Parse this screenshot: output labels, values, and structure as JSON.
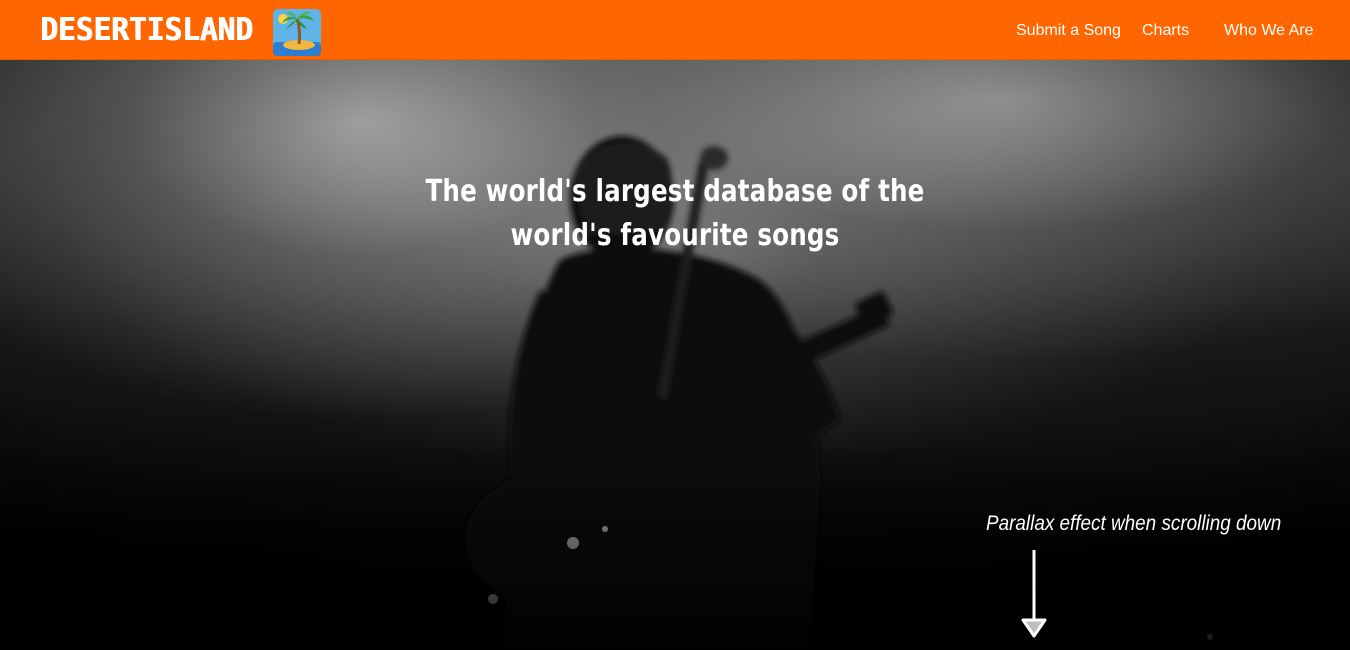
{
  "navbar": {
    "brand_text": "DESERTISLAND",
    "brand_logo": "desert-island-palm-tree-icon",
    "links": [
      {
        "label": "Submit a Song"
      },
      {
        "label": "Charts"
      },
      {
        "label": "Who We Are"
      }
    ],
    "background_color": "#ff6600"
  },
  "hero": {
    "headline": "The world's largest database of the world's favourite songs",
    "background_image": "black-and-white-guitarist-on-stage-photo",
    "annotation": "Parallax effect when scrolling down",
    "annotation_icon": "down-arrow-icon"
  }
}
